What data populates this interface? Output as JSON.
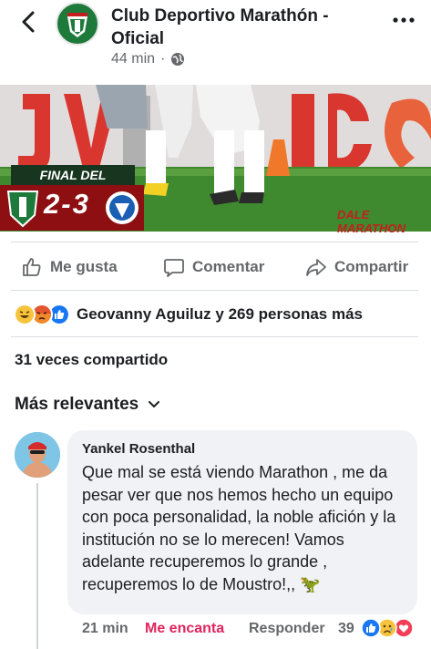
{
  "header": {
    "page_name": "Club Deportivo Marathón - Oficial",
    "time": "44 min",
    "separator": "·"
  },
  "post_image": {
    "banner_title": "FINAL DEL PARTIDO",
    "score": "2-3",
    "brand": "DALE MARATHON"
  },
  "actions": {
    "like": "Me gusta",
    "comment": "Comentar",
    "share": "Compartir"
  },
  "reactions": {
    "summary": "Geovanny Aguiluz y 269 personas más"
  },
  "shares": "31 veces compartido",
  "sort": {
    "label": "Más relevantes"
  },
  "comment": {
    "author": "Yankel Rosenthal",
    "text": "Que mal se está viendo Marathon , me da pesar ver que nos hemos hecho un equipo con poca personalidad, la noble afición y la institución no se lo merecen! Vamos adelante recuperemos lo grande , recuperemos lo de Moustro!,, 🦖",
    "time": "21 min",
    "reaction_label": "Me encanta",
    "reply": "Responder",
    "reaction_count": "39"
  },
  "colors": {
    "muted": "#65676b",
    "like_blue": "#1877f2",
    "love_red": "#e0245e",
    "bubble": "#f0f2f5"
  }
}
